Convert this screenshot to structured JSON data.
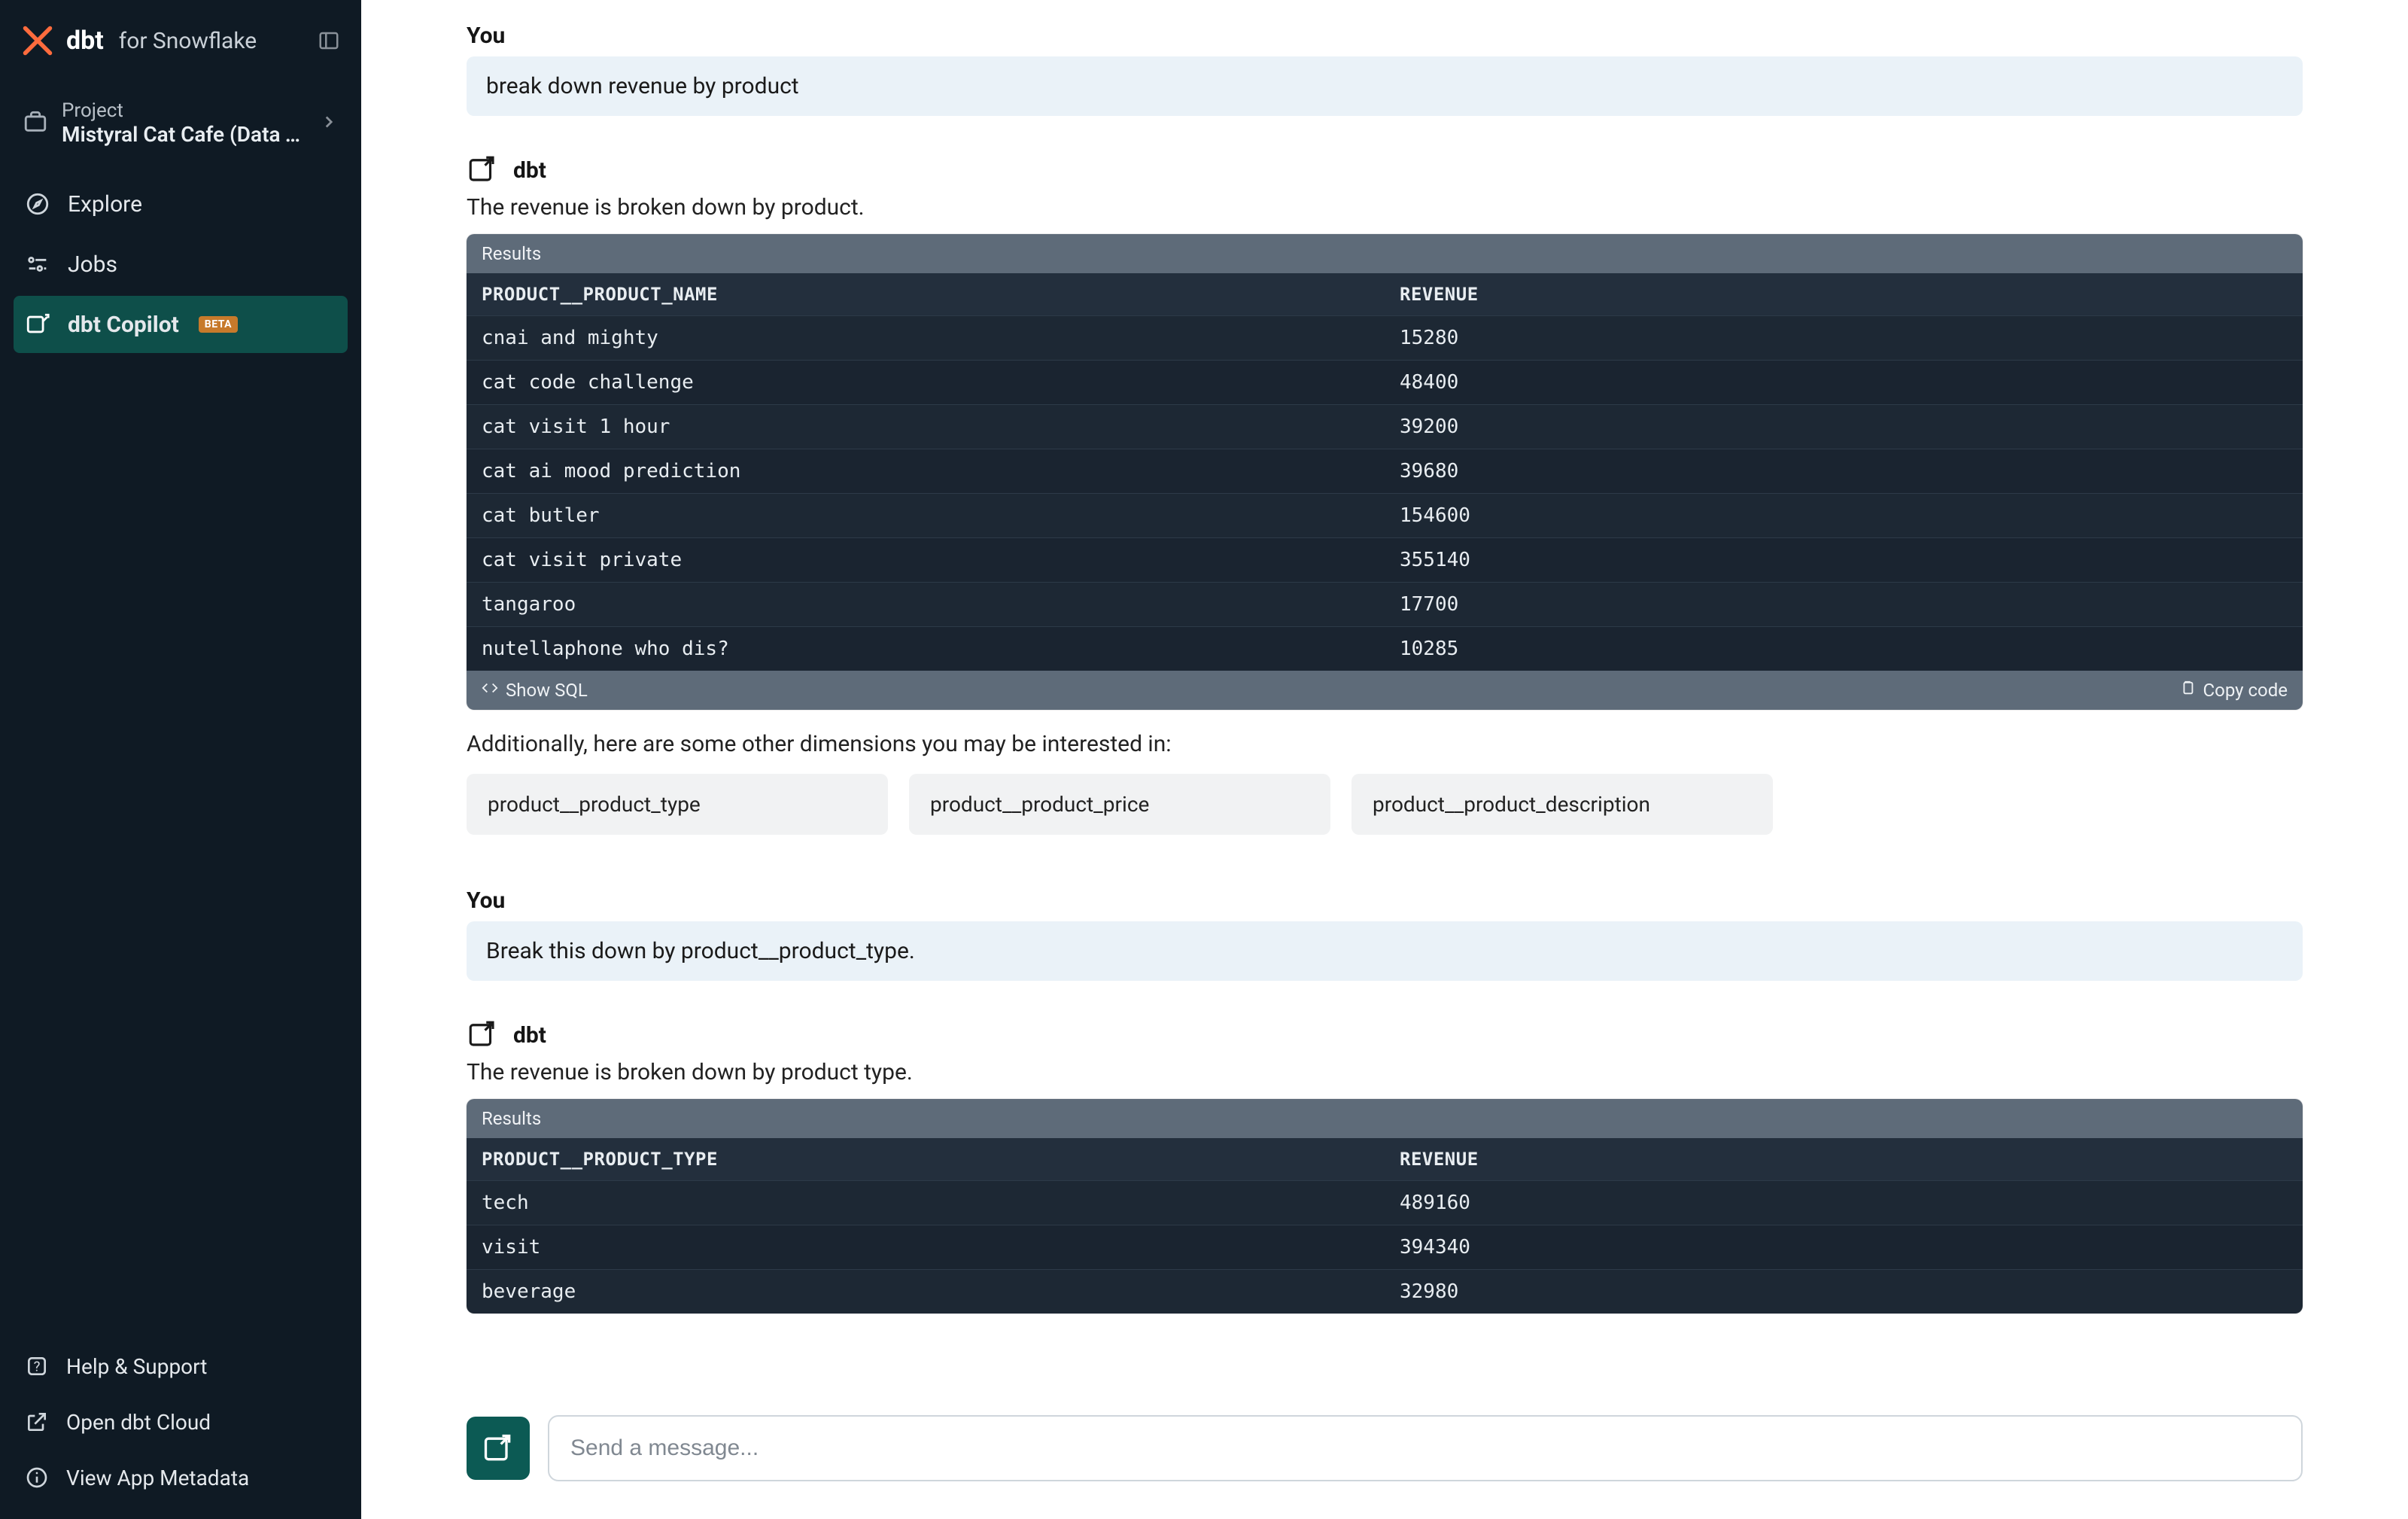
{
  "brand": {
    "name": "dbt",
    "suffix": "for Snowflake"
  },
  "project": {
    "label": "Project",
    "name": "Mistyral Cat Cafe (Data Te..."
  },
  "nav": {
    "explore": "Explore",
    "jobs": "Jobs",
    "copilot": "dbt Copilot",
    "copilot_badge": "BETA"
  },
  "bottom": {
    "help": "Help & Support",
    "open_cloud": "Open dbt Cloud",
    "metadata": "View App Metadata"
  },
  "chat": {
    "you_label": "You",
    "dbt_label": "dbt",
    "user1": "break down revenue by product",
    "dbt1_text": "The revenue is broken down by product.",
    "results_label": "Results",
    "show_sql": "Show SQL",
    "copy_code": "Copy code",
    "table1": {
      "col_product": "PRODUCT__PRODUCT_NAME",
      "col_revenue": "REVENUE",
      "rows": [
        {
          "p": "cnai and mighty",
          "r": "15280"
        },
        {
          "p": "cat code challenge",
          "r": "48400"
        },
        {
          "p": "cat visit 1 hour",
          "r": "39200"
        },
        {
          "p": "cat ai mood prediction",
          "r": "39680"
        },
        {
          "p": "cat butler",
          "r": "154600"
        },
        {
          "p": "cat visit private",
          "r": "355140"
        },
        {
          "p": "tangaroo",
          "r": "17700"
        },
        {
          "p": "nutellaphone who dis?",
          "r": "10285"
        }
      ]
    },
    "addl": "Additionally, here are some other dimensions you may be interested in:",
    "dims": {
      "d1": "product__product_type",
      "d2": "product__product_price",
      "d3": "product__product_description"
    },
    "user2": "Break this down by product__product_type.",
    "dbt2_text": "The revenue is broken down by product type.",
    "table2": {
      "col_product": "PRODUCT__PRODUCT_TYPE",
      "col_revenue": "REVENUE",
      "rows": [
        {
          "p": "tech",
          "r": "489160"
        },
        {
          "p": "visit",
          "r": "394340"
        },
        {
          "p": "beverage",
          "r": "32980"
        }
      ]
    },
    "input_placeholder": "Send a message..."
  }
}
